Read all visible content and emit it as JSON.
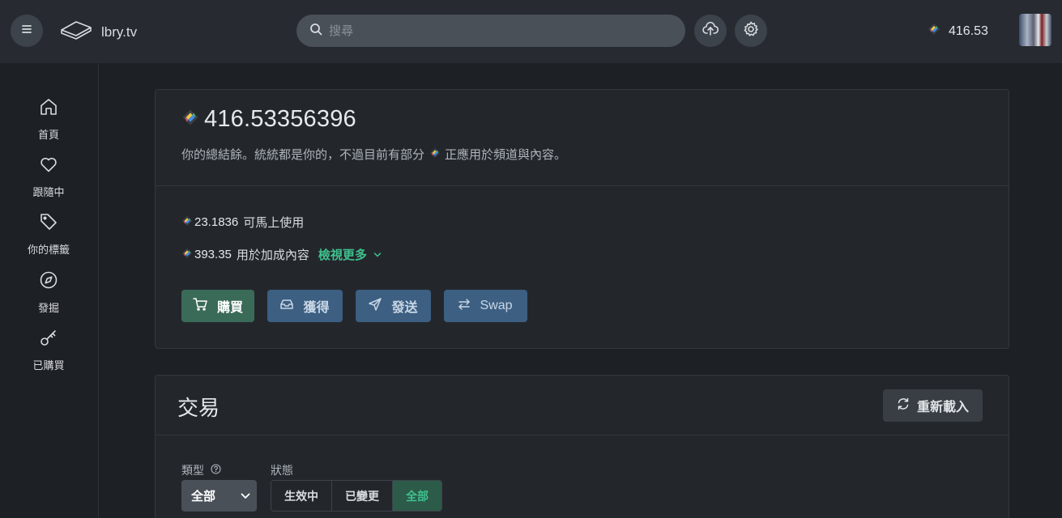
{
  "header": {
    "site_name": "lbry.tv",
    "search_placeholder": "搜尋",
    "balance": "416.53"
  },
  "sidebar": {
    "items": [
      {
        "label": "首頁",
        "icon": "home-icon"
      },
      {
        "label": "跟隨中",
        "icon": "heart-icon"
      },
      {
        "label": "你的標籤",
        "icon": "tag-icon"
      },
      {
        "label": "發掘",
        "icon": "compass-icon"
      },
      {
        "label": "已購買",
        "icon": "key-icon"
      }
    ]
  },
  "wallet": {
    "total_balance": "416.53356396",
    "description_before": "你的總結餘。統統都是你的，不過目前有部分",
    "description_after": "正應用於頻道與內容。",
    "available_amount": "23.1836",
    "available_label": "可馬上使用",
    "boost_amount": "393.35",
    "boost_label": "用於加成內容",
    "view_more": "檢視更多",
    "buttons": {
      "buy": "購買",
      "receive": "獲得",
      "send": "發送",
      "swap": "Swap"
    }
  },
  "transactions": {
    "title": "交易",
    "reload": "重新載入",
    "type_label": "類型",
    "type_value": "全部",
    "status_label": "狀態",
    "status_options": [
      "生效中",
      "已變更",
      "全部"
    ],
    "status_selected": "全部"
  },
  "colors": {
    "accent": "#3fc18e",
    "background": "#1d2024",
    "card": "#23272c",
    "header": "#272b31"
  }
}
